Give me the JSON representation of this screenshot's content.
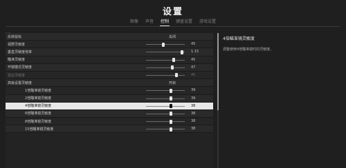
{
  "title": "设置",
  "tabs": [
    {
      "label": "图像",
      "active": false
    },
    {
      "label": "声音",
      "active": false
    },
    {
      "label": "控制",
      "active": true
    },
    {
      "label": "键盘设置",
      "active": false
    },
    {
      "label": "游戏设置",
      "active": false
    }
  ],
  "corner_mark": "......",
  "rows": [
    {
      "label": "反转鼠标",
      "kind": "choice",
      "value": "关闭"
    },
    {
      "label": "视野灵敏度",
      "kind": "slider",
      "value": "45",
      "fraction": 0.45
    },
    {
      "label": "垂直灵敏度倍率",
      "kind": "slider",
      "value": "1.15",
      "fraction": 0.92
    },
    {
      "label": "瞄准灵敏度",
      "kind": "slider",
      "value": "45",
      "fraction": 0.72
    },
    {
      "label": "开镜模式灵敏度",
      "kind": "slider",
      "value": "47",
      "fraction": 0.68
    },
    {
      "label": "狙击灵敏度",
      "kind": "slider",
      "value": "45",
      "fraction": 0.78,
      "dim": true
    },
    {
      "label": "高级设置灵敏度",
      "kind": "choice",
      "value": "开启"
    },
    {
      "label": "1倍瞄准镜灵敏度",
      "kind": "slider",
      "value": "39",
      "fraction": 0.65,
      "indent": true
    },
    {
      "label": "2倍瞄准镜灵敏度",
      "kind": "slider",
      "value": "39",
      "fraction": 0.65,
      "indent": true
    },
    {
      "label": "4倍瞄准镜灵敏度",
      "kind": "slider",
      "value": "38",
      "fraction": 0.64,
      "indent": true,
      "selected": true
    },
    {
      "label": "6倍瞄准镜灵敏度",
      "kind": "slider",
      "value": "38",
      "fraction": 0.64,
      "indent": true
    },
    {
      "label": "8倍瞄准镜灵敏度",
      "kind": "slider",
      "value": "38",
      "fraction": 0.64,
      "indent": true
    },
    {
      "label": "15倍瞄准镜灵敏度",
      "kind": "slider",
      "value": "38",
      "fraction": 0.64,
      "indent": true
    }
  ],
  "side_panel": {
    "title": "4倍瞄准镜灵敏度",
    "description": "调整使用4倍瞄准镜时的灵敏度。"
  }
}
